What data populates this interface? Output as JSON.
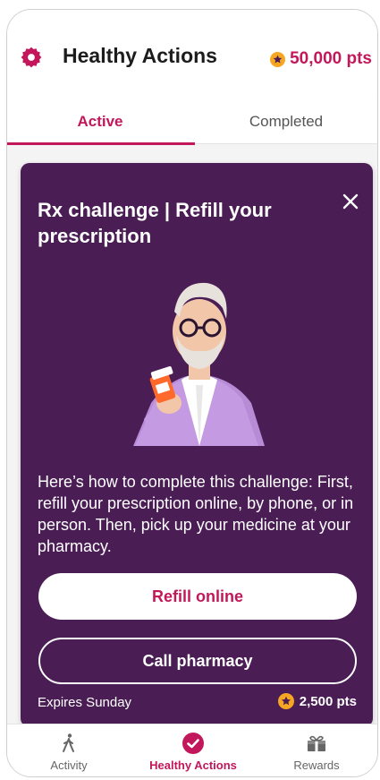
{
  "header": {
    "title": "Healthy Actions",
    "points": "50,000 pts",
    "icons": {
      "settings": "gear-icon",
      "points": "star-coin-icon"
    }
  },
  "tabs": [
    {
      "label": "Active",
      "active": true
    },
    {
      "label": "Completed",
      "active": false
    }
  ],
  "card": {
    "title": "Rx challenge | Refill your prescription",
    "description": "Here’s how to complete this challenge: First, refill your prescription online, by phone, or in person. Then, pick up your medicine at your pharmacy.",
    "primary_button": "Refill online",
    "secondary_button": "Call pharmacy",
    "expires": "Expires Sunday",
    "reward": "2,500 pts",
    "close_icon": "close-icon"
  },
  "bottom_nav": [
    {
      "label": "Activity",
      "icon": "walking-person-icon",
      "active": false
    },
    {
      "label": "Healthy Actions",
      "icon": "checkmark-circle-icon",
      "active": true
    },
    {
      "label": "Rewards",
      "icon": "gift-box-icon",
      "active": false
    }
  ],
  "colors": {
    "brand": "#c2185b",
    "card_background": "#4a1d54",
    "reward_coin": "#f5a623"
  }
}
